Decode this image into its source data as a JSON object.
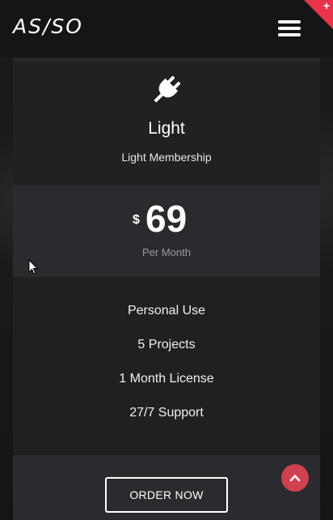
{
  "header": {
    "logo": "AS/SO",
    "menu_icon": "hamburger-menu-icon"
  },
  "corner_badge": {
    "symbol": "+",
    "color": "#e8334a"
  },
  "pricing_card": {
    "icon": "plug-icon",
    "title": "Light",
    "subtitle": "Light Membership",
    "currency": "$",
    "price": "69",
    "period": "Per Month",
    "features": [
      "Personal Use",
      "5 Projects",
      "1 Month License",
      "27/7 Support"
    ],
    "order_label": "ORDER NOW"
  },
  "scroll_top": {
    "icon": "chevron-up-icon",
    "color": "#d0404e"
  }
}
